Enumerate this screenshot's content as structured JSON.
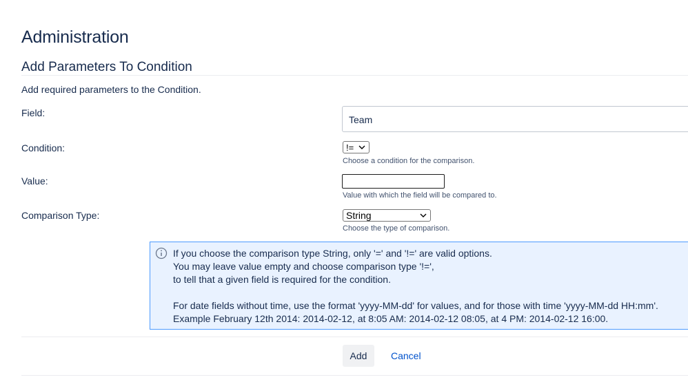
{
  "header": {
    "title": "Administration"
  },
  "section": {
    "title": "Add Parameters To Condition",
    "description": "Add required parameters to the Condition."
  },
  "form": {
    "field": {
      "label": "Field:",
      "value": "Team"
    },
    "condition": {
      "label": "Condition:",
      "selected": "!=",
      "help": "Choose a condition for the comparison."
    },
    "value": {
      "label": "Value:",
      "current": "",
      "help": "Value with which the field will be compared to."
    },
    "comparison_type": {
      "label": "Comparison Type:",
      "selected": "String",
      "help": "Choose the type of comparison."
    }
  },
  "info": {
    "icon": "info-circle-icon",
    "lines": [
      "If you choose the comparison type String, only '=' and '!=' are valid options.",
      "You may leave value empty and choose comparison type '!=',",
      "to tell that a given field is required for the condition.",
      "For date fields without time, use the format 'yyyy-MM-dd' for values, and for those with time 'yyyy-MM-dd HH:mm'.",
      "Example February 12th 2014: 2014-02-12, at 8:05 AM: 2014-02-12 08:05, at 4 PM: 2014-02-12 16:00."
    ]
  },
  "actions": {
    "add_label": "Add",
    "cancel_label": "Cancel"
  },
  "colors": {
    "text": "#172b4d",
    "link": "#0052cc",
    "info_bg": "#e9f2ff",
    "info_border": "#4c9aff",
    "button_bg": "#f0f1f3"
  }
}
